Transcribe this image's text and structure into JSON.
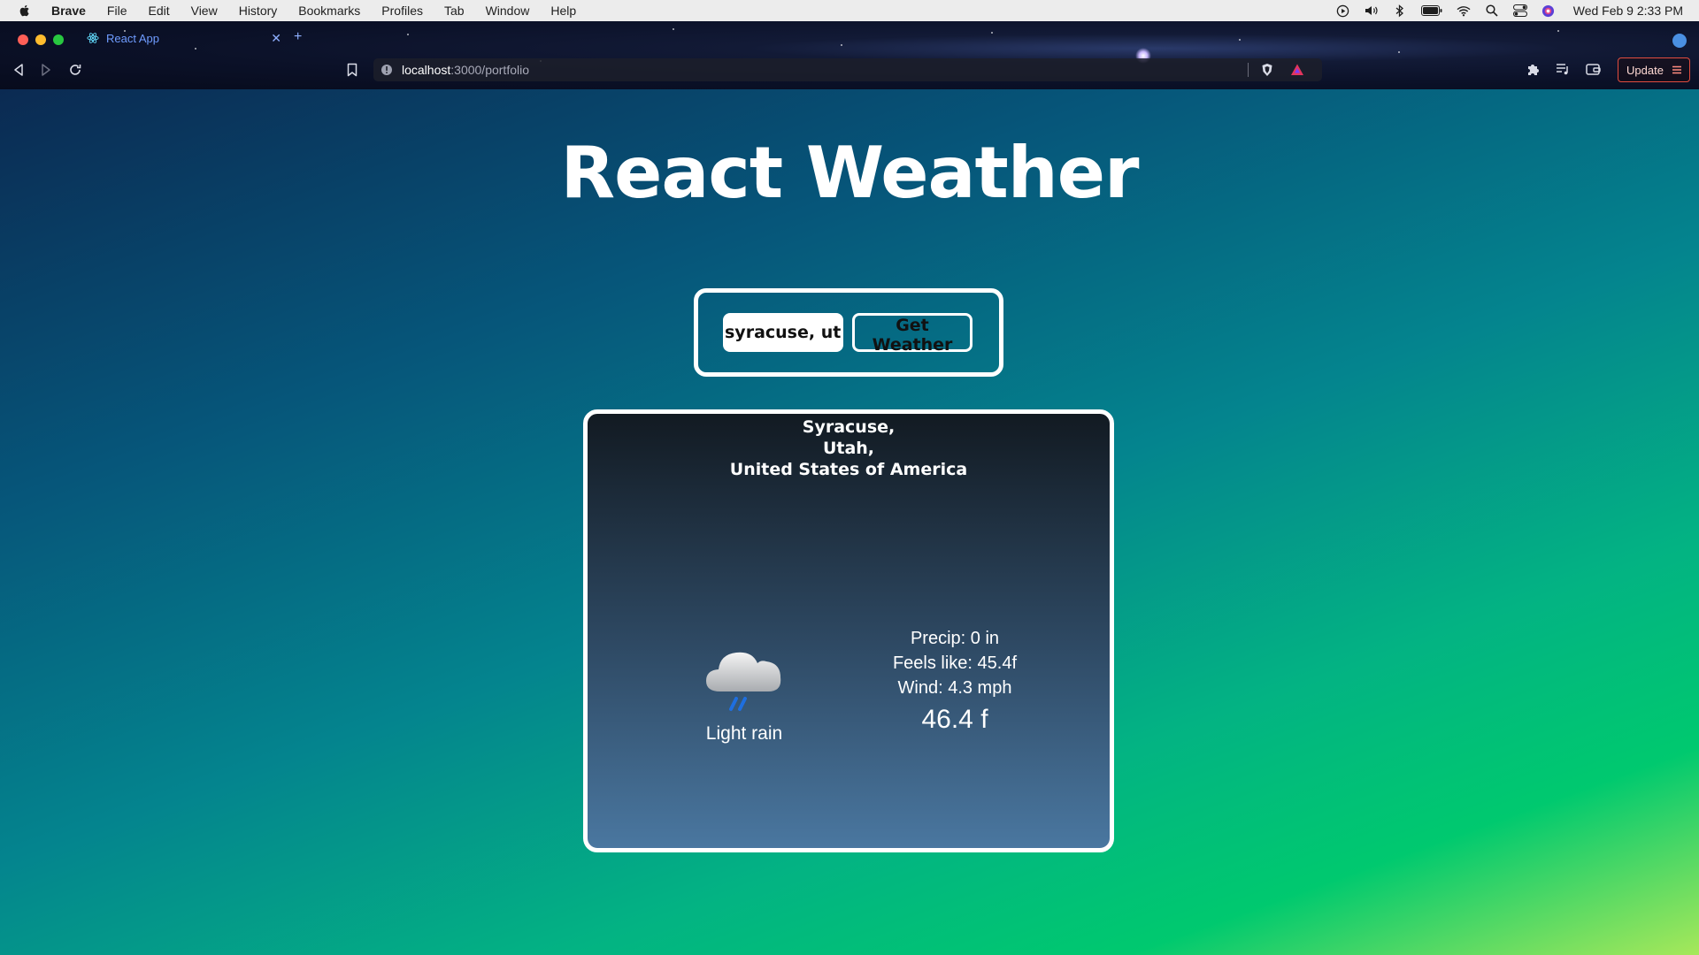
{
  "menubar": {
    "app_name": "Brave",
    "items": [
      "File",
      "Edit",
      "View",
      "History",
      "Bookmarks",
      "Profiles",
      "Tab",
      "Window",
      "Help"
    ],
    "clock": "Wed Feb 9  2:33 PM"
  },
  "browser": {
    "tab_title": "React App",
    "url_host": "localhost",
    "url_path": ":3000/portfolio",
    "update_label": "Update",
    "accent_color": "#e24c3f"
  },
  "app": {
    "title": "React Weather",
    "search": {
      "input_value": "syracuse, utah",
      "button_label": "Get Weather"
    },
    "weather": {
      "city": "Syracuse,",
      "region": "Utah,",
      "country": "United States of America",
      "icon": "cloud-rain-icon",
      "condition": "Light rain",
      "precip": "Precip: 0 in",
      "feels_like": "Feels like: 45.4f",
      "wind": "Wind: 4.3 mph",
      "temperature": "46.4 f"
    }
  }
}
